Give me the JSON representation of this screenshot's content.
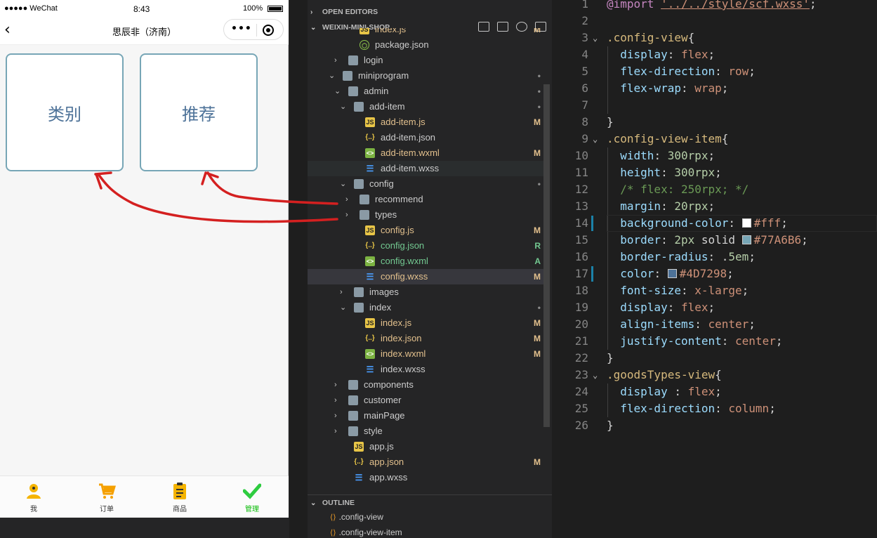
{
  "simulator": {
    "status": {
      "carrier": "●●●●● WeChat",
      "time": "8:43",
      "battery": "100%"
    },
    "nav": {
      "title": "思辰非（济南）",
      "back_icon": "chevron-left-icon",
      "capsule_more": "•••"
    },
    "config_items": [
      "类别",
      "推荐"
    ],
    "tabs": [
      {
        "label": "我",
        "icon": "person-icon"
      },
      {
        "label": "订单",
        "icon": "cart-icon"
      },
      {
        "label": "商品",
        "icon": "clipboard-icon"
      },
      {
        "label": "管理",
        "icon": "check-icon",
        "active": true
      }
    ],
    "colors": {
      "item_border": "#77A6B6",
      "item_text": "#4D7298",
      "active_tab": "#09bb07"
    }
  },
  "explorer": {
    "open_editors": "OPEN EDITORS",
    "project": "WEIXIN-MINI-SHOP",
    "tree": [
      {
        "name": "index.js",
        "icon": "js-icon",
        "status": "M"
      },
      {
        "name": "package.json",
        "icon": "package-icon",
        "status": ""
      },
      {
        "name": "login",
        "icon": "folder-icon",
        "status": ""
      },
      {
        "name": "miniprogram",
        "icon": "folder-open-icon",
        "status": "•"
      },
      {
        "name": "admin",
        "icon": "folder-open-icon",
        "status": "•"
      },
      {
        "name": "add-item",
        "icon": "folder-open-icon",
        "status": "•"
      },
      {
        "name": "add-item.js",
        "icon": "js-icon",
        "status": "M"
      },
      {
        "name": "add-item.json",
        "icon": "json-icon",
        "status": ""
      },
      {
        "name": "add-item.wxml",
        "icon": "wxml-icon",
        "status": "M"
      },
      {
        "name": "add-item.wxss",
        "icon": "wxss-icon",
        "status": ""
      },
      {
        "name": "config",
        "icon": "folder-open-icon",
        "status": "•"
      },
      {
        "name": "recommend",
        "icon": "folder-icon",
        "status": ""
      },
      {
        "name": "types",
        "icon": "folder-icon",
        "status": ""
      },
      {
        "name": "config.js",
        "icon": "js-icon",
        "status": "M"
      },
      {
        "name": "config.json",
        "icon": "json-icon",
        "status": "R"
      },
      {
        "name": "config.wxml",
        "icon": "wxml-icon",
        "status": "A"
      },
      {
        "name": "config.wxss",
        "icon": "wxss-icon",
        "status": "M"
      },
      {
        "name": "images",
        "icon": "folder-icon",
        "status": ""
      },
      {
        "name": "index",
        "icon": "folder-open-icon",
        "status": "•"
      },
      {
        "name": "index.js",
        "icon": "js-icon",
        "status": "M"
      },
      {
        "name": "index.json",
        "icon": "json-icon",
        "status": "M"
      },
      {
        "name": "index.wxml",
        "icon": "wxml-icon",
        "status": "M"
      },
      {
        "name": "index.wxss",
        "icon": "wxss-icon",
        "status": ""
      },
      {
        "name": "components",
        "icon": "folder-icon",
        "status": ""
      },
      {
        "name": "customer",
        "icon": "folder-icon",
        "status": ""
      },
      {
        "name": "mainPage",
        "icon": "folder-icon",
        "status": ""
      },
      {
        "name": "style",
        "icon": "folder-icon",
        "status": ""
      },
      {
        "name": "app.js",
        "icon": "js-icon",
        "status": ""
      },
      {
        "name": "app.json",
        "icon": "json-icon",
        "status": "M"
      },
      {
        "name": "app.wxss",
        "icon": "wxss-icon",
        "status": ""
      }
    ],
    "outline_title": "OUTLINE",
    "outline": [
      ".config-view",
      ".config-view-item"
    ]
  },
  "editor": {
    "lines": [
      "@import '../../style/scf.wxss';",
      "",
      ".config-view{",
      "  display: flex;",
      "  flex-direction: row;",
      "  flex-wrap: wrap;",
      "",
      "}",
      ".config-view-item{",
      "  width: 300rpx;",
      "  height: 300rpx;",
      "  /* flex: 250rpx; */",
      "  margin: 20rpx;",
      "  background-color: #fff;",
      "  border: 2px solid #77A6B6;",
      "  border-radius: .5em;",
      "  color: #4D7298;",
      "  font-size: x-large;",
      "  display: flex;",
      "  align-items: center;",
      "  justify-content: center;",
      "}",
      ".goodsTypes-view{",
      "  display : flex;",
      "  flex-direction: column;",
      "}"
    ],
    "swatch_colors": {
      "14": "#fff",
      "15": "#77A6B6",
      "17": "#4D7298"
    }
  },
  "annotation": {
    "arrow_color": "#d42020"
  }
}
